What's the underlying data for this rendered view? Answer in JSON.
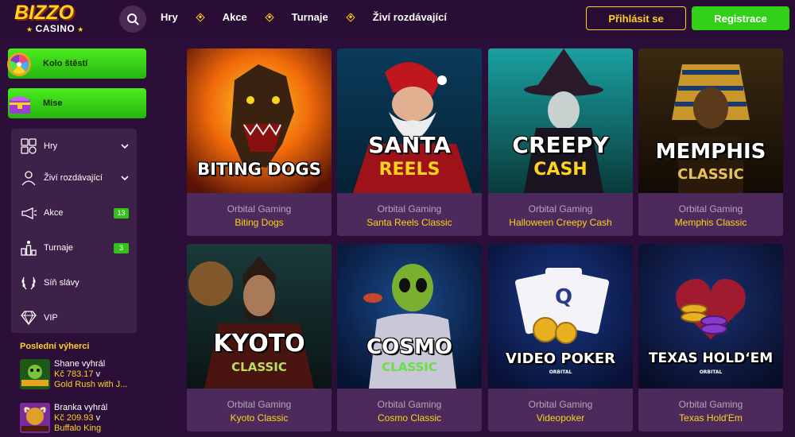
{
  "header": {
    "logo_main": "BIZZO",
    "logo_sub": "CASINO",
    "nav": [
      "Hry",
      "Akce",
      "Turnaje",
      "Živí rozdávající"
    ],
    "login_label": "Přihlásit se",
    "register_label": "Registrace"
  },
  "sidebar": {
    "promos": [
      {
        "label": "Kolo štěstí",
        "icon": "wheel-icon"
      },
      {
        "label": "Mise",
        "icon": "treasure-chest-icon"
      }
    ],
    "menu": [
      {
        "label": "Hry",
        "icon": "games-icon",
        "chevron": true
      },
      {
        "label": "Živí rozdávající",
        "icon": "live-dealer-icon",
        "chevron": true
      },
      {
        "label": "Akce",
        "icon": "megaphone-icon",
        "badge": "13"
      },
      {
        "label": "Turnaje",
        "icon": "tournament-icon",
        "badge": "3"
      },
      {
        "label": "Síň slávy",
        "icon": "laurel-icon"
      },
      {
        "label": "VIP",
        "icon": "diamond-icon"
      }
    ],
    "winners_title": "Poslední výherci",
    "winners": [
      {
        "name": "Shane vyhrál",
        "amount": "Kč 783.17",
        "conj": "v",
        "game": "Gold Rush with J..."
      },
      {
        "name": "Branka vyhrál",
        "amount": "Kč 209.93",
        "conj": "v",
        "game": "Buffalo King"
      }
    ]
  },
  "games": [
    {
      "provider": "Orbital Gaming",
      "title": "Biting Dogs",
      "art_title": "BITING DOGS",
      "art_sub": ""
    },
    {
      "provider": "Orbital Gaming",
      "title": "Santa Reels Classic",
      "art_title": "SANTA",
      "art_sub": "REELS"
    },
    {
      "provider": "Orbital Gaming",
      "title": "Halloween Creepy Cash",
      "art_title": "CREEPY",
      "art_sub": "CASH"
    },
    {
      "provider": "Orbital Gaming",
      "title": "Memphis Classic",
      "art_title": "MEMPHIS",
      "art_sub": "CLASSIC"
    },
    {
      "provider": "Orbital Gaming",
      "title": "Kyoto Classic",
      "art_title": "KYOTO",
      "art_sub": "CLASSIC"
    },
    {
      "provider": "Orbital Gaming",
      "title": "Cosmo Classic",
      "art_title": "COSMO",
      "art_sub": "CLASSIC"
    },
    {
      "provider": "Orbital Gaming",
      "title": "Videopoker",
      "art_title": "VIDEO POKER",
      "art_sub": "ORBITAL"
    },
    {
      "provider": "Orbital Gaming",
      "title": "Texas Hold'Em",
      "art_title": "TEXAS HOLD‘EM",
      "art_sub": "ORBITAL"
    }
  ],
  "colors": {
    "background": "#2c0f38",
    "accent_yellow": "#ffd21c",
    "accent_green": "#33d01a"
  }
}
